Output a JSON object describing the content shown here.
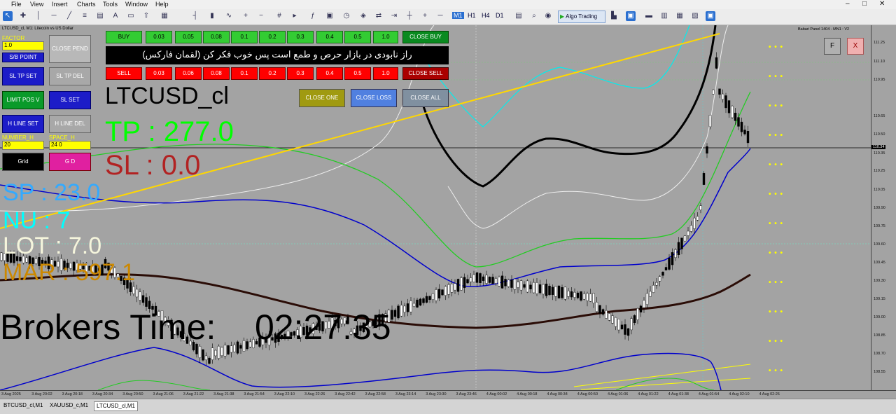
{
  "menu": {
    "items": [
      "File",
      "View",
      "Insert",
      "Charts",
      "Tools",
      "Window",
      "Help"
    ],
    "window_controls": [
      "–",
      "□",
      "✕"
    ]
  },
  "toolbar": {
    "timeframes": [
      "M1",
      "H1",
      "H4",
      "D1"
    ],
    "algo_trading_label": "Algo Trading"
  },
  "chart": {
    "info_title": "LTCUSD_cl, M1: Litecoin vs US Dollar",
    "panel_name": "Babari Panel 1404 - MN1 : V2",
    "price_ticks": [
      "111.25",
      "111.10",
      "110.95",
      "110.65",
      "110.50",
      "110.35",
      "110.25",
      "110.05",
      "109.90",
      "109.75",
      "109.60",
      "109.45",
      "109.30",
      "109.15",
      "109.00",
      "108.85",
      "108.70",
      "108.55"
    ],
    "current_price": "110.34",
    "time_ticks": [
      "3 Aug 2025",
      "3 Aug 20:02",
      "3 Aug 20:18",
      "3 Aug 20:34",
      "3 Aug 20:50",
      "3 Aug 21:06",
      "3 Aug 21:22",
      "3 Aug 21:38",
      "3 Aug 21:54",
      "3 Aug 22:10",
      "3 Aug 22:26",
      "3 Aug 22:42",
      "3 Aug 22:58",
      "3 Aug 23:14",
      "3 Aug 23:30",
      "3 Aug 23:46",
      "4 Aug 00:02",
      "4 Aug 00:18",
      "4 Aug 00:34",
      "4 Aug 00:50",
      "4 Aug 01:06",
      "4 Aug 01:22",
      "4 Aug 01:38",
      "4 Aug 01:54",
      "4 Aug 02:10",
      "4 Aug 02:26"
    ]
  },
  "panel": {
    "factor_label": "FACTOR",
    "factor_value": "1.0",
    "sb_point": "S/B POINT",
    "close_pend": "CLOSE PEND",
    "sl_tp_set": "SL TP SET",
    "sl_tp_del": "SL TP DEL",
    "limit_pos_v": "LIMIT POS V",
    "sl_set": "SL SET",
    "h_line_set": "H LINE SET",
    "h_line_del": "H LINE DEL",
    "number_h_label": "NUMBER_H",
    "number_h_value": "20",
    "space_h_label": "SPACE_H",
    "space_h_value": "24 0",
    "grid": "Grid",
    "gd": "G D",
    "buy": "BUY",
    "buy_lots": [
      "0.03",
      "0.05",
      "0.08",
      "0.1",
      "0.2",
      "0.3",
      "0.4",
      "0.5",
      "1.0"
    ],
    "close_buy": "CLOSE BUY",
    "sell": "SELL",
    "sell_lots": [
      "0.03",
      "0.06",
      "0.08",
      "0.1",
      "0.2",
      "0.3",
      "0.4",
      "0.5",
      "1.0"
    ],
    "close_sell": "CLOSE SELL",
    "persian_banner": "راز نابودی در بازار حرص و طمع است  پس خوب فکر کن (لقمان فارکس)",
    "close_one": "CLOSE ONE",
    "close_loss": "CLOSE LOSS",
    "close_all": "CLOSE ALL",
    "f_btn": "F",
    "x_btn": "X"
  },
  "overlay": {
    "symbol": "LTCUSD_cl",
    "tp": "TP : 277.0",
    "sl": "SL : 0.0",
    "sp": "SP : 23.0",
    "nu": "NU : 7",
    "lot": "LOT : 7.0",
    "mar": "MAR : 597.1",
    "brokers_time": "Brokers Time:    02:27:35"
  },
  "tabs": [
    "BTCUSD_cl,M1",
    "XAUUSD_c,M1",
    "LTCUSD_cl,M1"
  ],
  "colors": {
    "chart_bg": "#a3a3a3",
    "tp_color": "#00ff00",
    "sl_color": "#b22222",
    "sp_color": "#33aaff",
    "nu_color": "#00ffff",
    "lot_color": "#f5f5dc",
    "mar_color": "#cc8800",
    "trend_line": "#ffd700"
  }
}
